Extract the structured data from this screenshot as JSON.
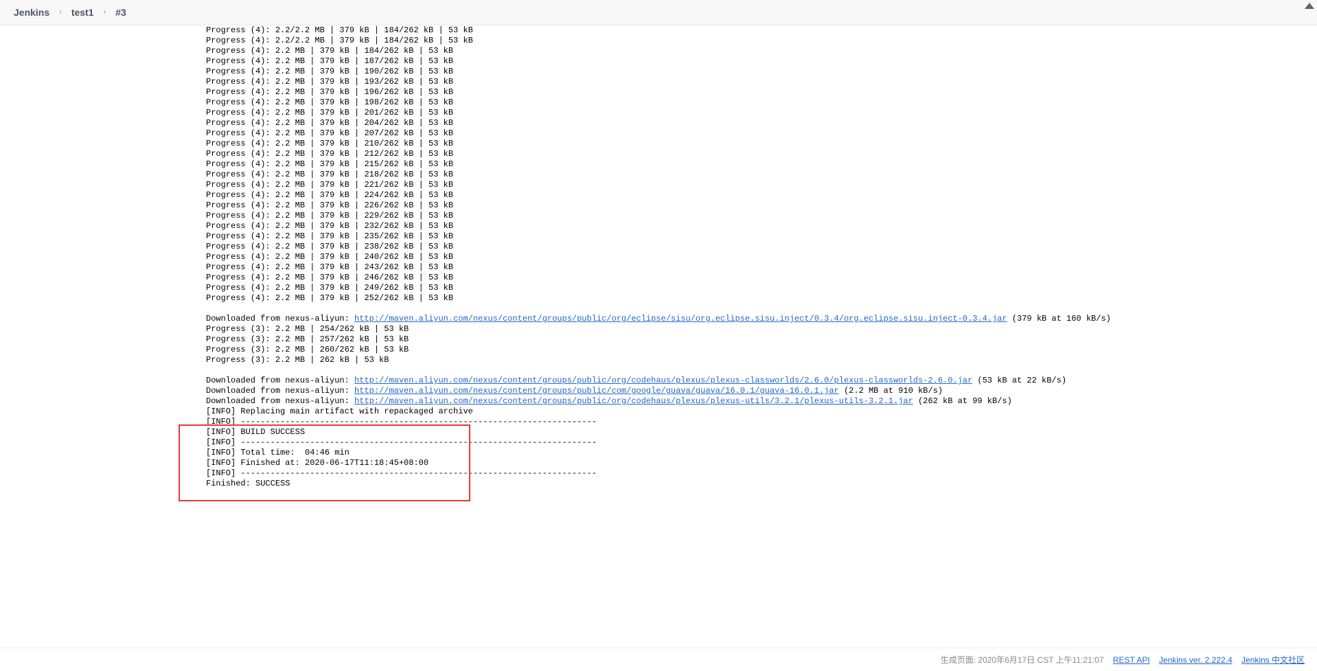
{
  "breadcrumb": {
    "root": "Jenkins",
    "job": "test1",
    "build": "#3"
  },
  "console": {
    "block1": [
      "Progress (4): 2.2/2.2 MB | 379 kB | 184/262 kB | 53 kB",
      "Progress (4): 2.2/2.2 MB | 379 kB | 184/262 kB | 53 kB",
      "Progress (4): 2.2 MB | 379 kB | 184/262 kB | 53 kB",
      "Progress (4): 2.2 MB | 379 kB | 187/262 kB | 53 kB",
      "Progress (4): 2.2 MB | 379 kB | 190/262 kB | 53 kB",
      "Progress (4): 2.2 MB | 379 kB | 193/262 kB | 53 kB",
      "Progress (4): 2.2 MB | 379 kB | 196/262 kB | 53 kB",
      "Progress (4): 2.2 MB | 379 kB | 198/262 kB | 53 kB",
      "Progress (4): 2.2 MB | 379 kB | 201/262 kB | 53 kB",
      "Progress (4): 2.2 MB | 379 kB | 204/262 kB | 53 kB",
      "Progress (4): 2.2 MB | 379 kB | 207/262 kB | 53 kB",
      "Progress (4): 2.2 MB | 379 kB | 210/262 kB | 53 kB",
      "Progress (4): 2.2 MB | 379 kB | 212/262 kB | 53 kB",
      "Progress (4): 2.2 MB | 379 kB | 215/262 kB | 53 kB",
      "Progress (4): 2.2 MB | 379 kB | 218/262 kB | 53 kB",
      "Progress (4): 2.2 MB | 379 kB | 221/262 kB | 53 kB",
      "Progress (4): 2.2 MB | 379 kB | 224/262 kB | 53 kB",
      "Progress (4): 2.2 MB | 379 kB | 226/262 kB | 53 kB",
      "Progress (4): 2.2 MB | 379 kB | 229/262 kB | 53 kB",
      "Progress (4): 2.2 MB | 379 kB | 232/262 kB | 53 kB",
      "Progress (4): 2.2 MB | 379 kB | 235/262 kB | 53 kB",
      "Progress (4): 2.2 MB | 379 kB | 238/262 kB | 53 kB",
      "Progress (4): 2.2 MB | 379 kB | 240/262 kB | 53 kB",
      "Progress (4): 2.2 MB | 379 kB | 243/262 kB | 53 kB",
      "Progress (4): 2.2 MB | 379 kB | 246/262 kB | 53 kB",
      "Progress (4): 2.2 MB | 379 kB | 249/262 kB | 53 kB",
      "Progress (4): 2.2 MB | 379 kB | 252/262 kB | 53 kB"
    ],
    "download1_prefix": "Downloaded from nexus-aliyun: ",
    "download1_link": "http://maven.aliyun.com/nexus/content/groups/public/org/eclipse/sisu/org.eclipse.sisu.inject/0.3.4/org.eclipse.sisu.inject-0.3.4.jar",
    "download1_suffix": " (379 kB at 160 kB/s)",
    "block2": [
      "Progress (3): 2.2 MB | 254/262 kB | 53 kB",
      "Progress (3): 2.2 MB | 257/262 kB | 53 kB",
      "Progress (3): 2.2 MB | 260/262 kB | 53 kB",
      "Progress (3): 2.2 MB | 262 kB | 53 kB"
    ],
    "download2_prefix": "Downloaded from nexus-aliyun: ",
    "download2_link": "http://maven.aliyun.com/nexus/content/groups/public/org/codehaus/plexus/plexus-classworlds/2.6.0/plexus-classworlds-2.6.0.jar",
    "download2_suffix": " (53 kB at 22 kB/s)",
    "download3_prefix": "Downloaded from nexus-aliyun: ",
    "download3_link": "http://maven.aliyun.com/nexus/content/groups/public/com/google/guava/guava/16.0.1/guava-16.0.1.jar",
    "download3_suffix": " (2.2 MB at 910 kB/s)",
    "download4_prefix": "Downloaded from nexus-aliyun: ",
    "download4_link": "http://maven.aliyun.com/nexus/content/groups/public/org/codehaus/plexus/plexus-utils/3.2.1/plexus-utils-3.2.1.jar",
    "download4_suffix": " (262 kB at 99 kB/s)",
    "info_block": [
      "[INFO] Replacing main artifact with repackaged archive",
      "[INFO] ------------------------------------------------------------------------",
      "[INFO] BUILD SUCCESS",
      "[INFO] ------------------------------------------------------------------------",
      "[INFO] Total time:  04:46 min",
      "[INFO] Finished at: 2020-06-17T11:18:45+08:00",
      "[INFO] ------------------------------------------------------------------------",
      "Finished: SUCCESS"
    ]
  },
  "footer": {
    "generated_label": "生成页面:",
    "generated_time": "2020年6月17日 CST 上午11:21:07",
    "rest_api": "REST API",
    "version": "Jenkins ver. 2.222.4",
    "community": "Jenkins 中文社区"
  }
}
